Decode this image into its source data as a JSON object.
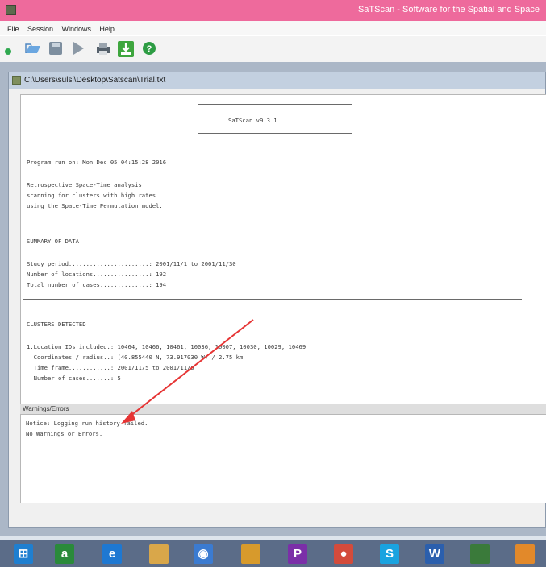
{
  "window": {
    "title": "SaTScan - Software for the Spatial and Space"
  },
  "menu": [
    "File",
    "Session",
    "Windows",
    "Help"
  ],
  "toolbar": {
    "icons": [
      "new-session-icon",
      "open-session-icon",
      "save-session-icon",
      "execute-icon",
      "print-icon",
      "download-icon",
      "help-icon"
    ]
  },
  "document": {
    "path": "C:\\Users\\sulsi\\Desktop\\Satscan\\Trial.txt",
    "header": "SaTScan v9.3.1",
    "run_line": "Program run on: Mon Dec 05 04:15:28 2016",
    "analysis_lines": [
      "Retrospective Space-Time analysis",
      "scanning for clusters with high rates",
      "using the Space-Time Permutation model."
    ],
    "summary_heading": "SUMMARY OF DATA",
    "summary_lines": [
      "Study period.......................: 2001/11/1 to 2001/11/30",
      "Number of locations................: 192",
      "Total number of cases..............: 194"
    ],
    "clusters_heading": "CLUSTERS DETECTED",
    "cluster_lines": [
      "1.Location IDs included.: 10464, 10466, 10461, 10036, 10007, 10030, 10029, 10469",
      "  Coordinates / radius..: (40.855440 N, 73.917030 W) / 2.75 km",
      "  Time frame............: 2001/11/5 to 2001/11/5",
      "  Number of cases.......: 5"
    ]
  },
  "warnings": {
    "label": "Warnings/Errors",
    "lines": [
      "Notice: Logging run history failed.",
      "No Warnings or Errors."
    ]
  },
  "taskbar": {
    "items": [
      {
        "name": "start-button",
        "color": "#1f7fd0",
        "glyph": "⊞"
      },
      {
        "name": "store-app",
        "color": "#2a8a3a",
        "glyph": "a"
      },
      {
        "name": "internet-explorer",
        "color": "#1e78d2",
        "glyph": "e"
      },
      {
        "name": "file-explorer",
        "color": "#d9a74a",
        "glyph": ""
      },
      {
        "name": "network-app",
        "color": "#3b7bd1",
        "glyph": "◉"
      },
      {
        "name": "photos-app",
        "color": "#d79a2c",
        "glyph": ""
      },
      {
        "name": "search-app",
        "color": "#7b2fa8",
        "glyph": "P"
      },
      {
        "name": "chrome",
        "color": "#d34b3b",
        "glyph": "●"
      },
      {
        "name": "skype",
        "color": "#1aa3e0",
        "glyph": "S"
      },
      {
        "name": "word",
        "color": "#2b5fad",
        "glyph": "W"
      },
      {
        "name": "satscan-app",
        "color": "#3a7a3a",
        "glyph": ""
      },
      {
        "name": "orange-app",
        "color": "#e2892a",
        "glyph": ""
      }
    ]
  },
  "annotation": {
    "arrow_color": "#e63434"
  }
}
